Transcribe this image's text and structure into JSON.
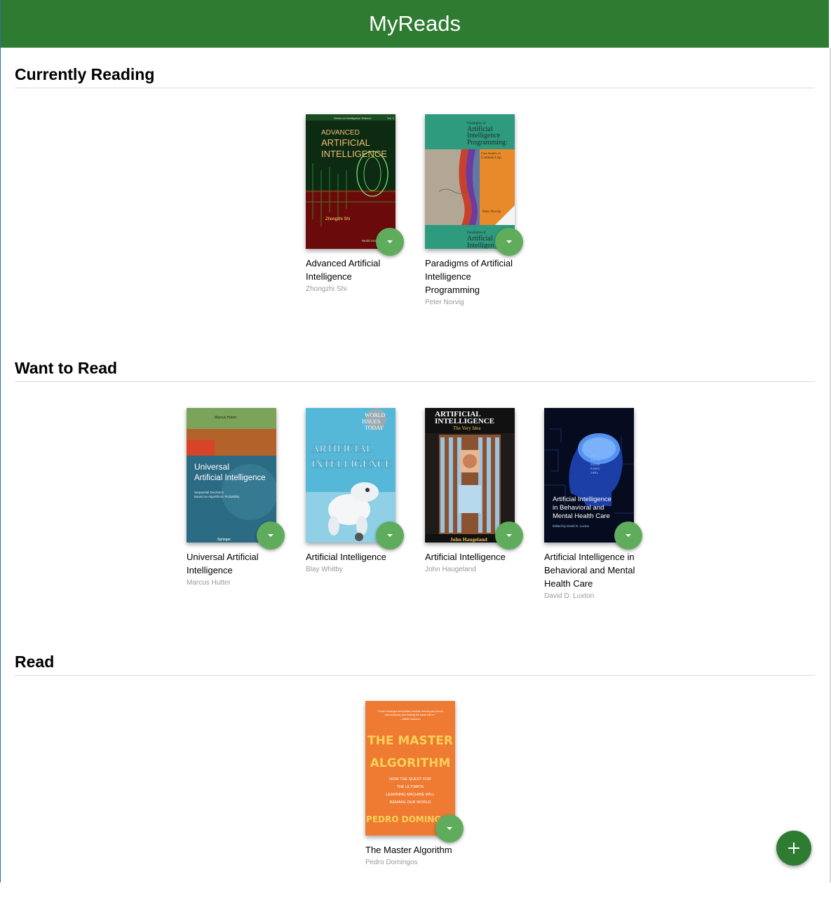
{
  "app": {
    "title": "MyReads"
  },
  "shelves": [
    {
      "title": "Currently Reading",
      "books": [
        {
          "title": "Advanced Artificial Intelligence",
          "author": "Zhongzhi Shi"
        },
        {
          "title": "Paradigms of Artificial Intelligence Programming",
          "author": "Peter Norvig"
        }
      ]
    },
    {
      "title": "Want to Read",
      "books": [
        {
          "title": "Universal Artificial Intelligence",
          "author": "Marcus Hutter"
        },
        {
          "title": "Artificial Intelligence",
          "author": "Blay Whitby"
        },
        {
          "title": "Artificial Intelligence",
          "author": "John Haugeland"
        },
        {
          "title": "Artificial Intelligence in Behavioral and Mental Health Care",
          "author": "David D. Luxton"
        }
      ]
    },
    {
      "title": "Read",
      "books": [
        {
          "title": "The Master Algorithm",
          "author": "Pedro Domingos"
        }
      ]
    }
  ],
  "covers": {
    "c0": {
      "series": "Series on Intelligence Science",
      "vol": "Vol. 1",
      "line1": "ADVANCED",
      "line2": "ARTIFICIAL",
      "line3": "INTELLIGENCE",
      "author": "Zhongzhi Shi",
      "publisher": "World Scientific"
    },
    "c1": {
      "top1": "Paradigms of",
      "top2": "Artificial",
      "top3": "Intelligence",
      "top4": "Programming:",
      "sub1": "Case Studies in",
      "sub2": "Common Lisp",
      "author": "Peter Norvig",
      "bottom1": "Paradigms of",
      "bottom2": "Artificial",
      "bottom3": "Intelligen"
    },
    "c2": {
      "author": "Marcus Hutter",
      "line1": "Universal",
      "line2": "Artificial Intelligence",
      "sub1": "Sequential Decisions",
      "sub2": "Based on Algorithmic Probability",
      "publisher": "Springer"
    },
    "c3": {
      "badge1": "WORLD",
      "badge2": "ISSUES",
      "badge3": "TODAY",
      "line1": "ARTIFICIAL",
      "line2": "INTELLIGENCE"
    },
    "c4": {
      "line1": "ARTIFICIAL",
      "line2": "INTELLIGENCE",
      "line3": "The Very Idea",
      "author": "John Haugeland"
    },
    "c5": {
      "digits": "0101\n10110\n01100\n01001\n1001",
      "line1": "Artificial Intelligence",
      "line2": "in Behavioral and",
      "line3": "Mental Health Care",
      "editor": "Edited by David D. Luxton"
    },
    "c6": {
      "quote1": "\"Pedro Domingos demystifies machine learning and shows",
      "quote2": "how wondrous and exciting the future will be.\"",
      "quote3": "—Walter Isaacson",
      "line1": "THE MASTER",
      "line2": "ALGORITHM",
      "sub1": "HOW THE QUEST FOR",
      "sub2": "THE ULTIMATE",
      "sub3": "LEARNING MACHINE WILL",
      "sub4": "REMAKE OUR WORLD",
      "author": "PEDRO DOMINGOS"
    }
  },
  "colors": {
    "primary": "#2e7c31",
    "shelf_changer": "#60ac5d",
    "author_text": "#999999"
  },
  "icons": {
    "shelf_changer": "caret-down-icon",
    "add": "plus-icon"
  }
}
